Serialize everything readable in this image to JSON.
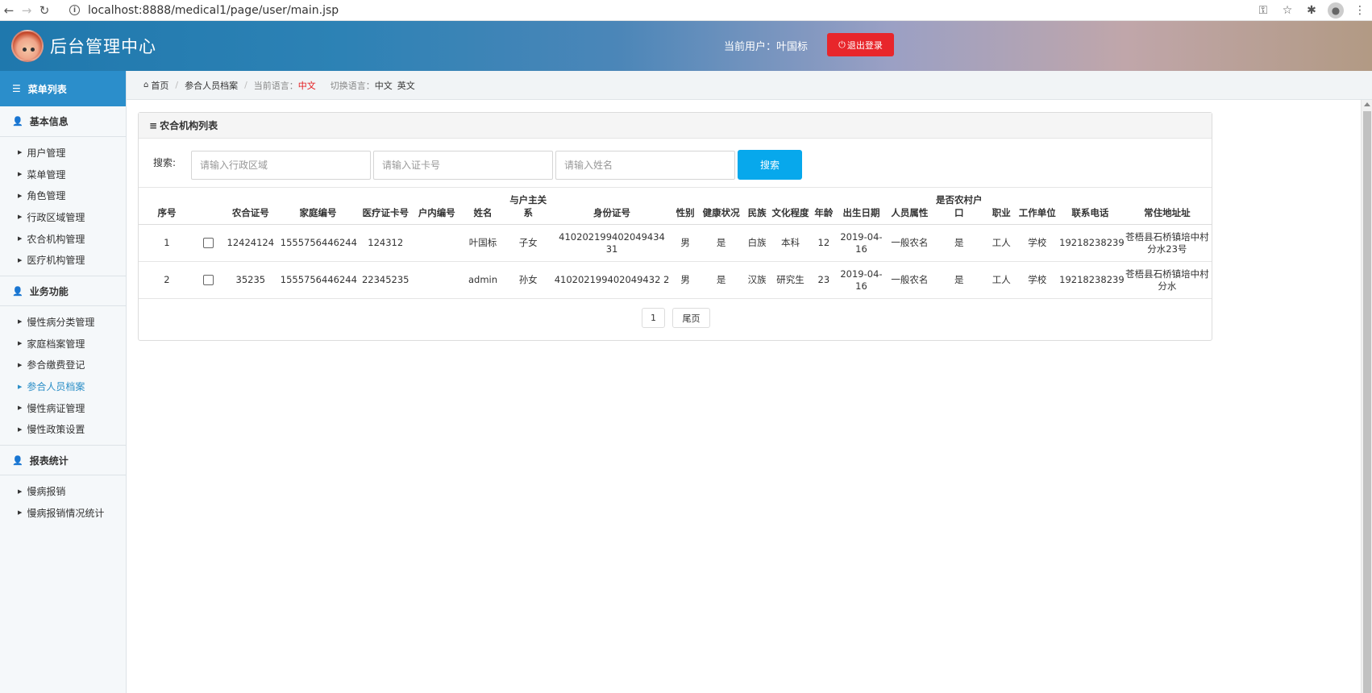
{
  "browser": {
    "url": "localhost:8888/medical1/page/user/main.jsp"
  },
  "header": {
    "title": "后台管理中心",
    "current_user_label": "当前用户：",
    "current_user": "叶国标",
    "logout_label": "退出登录"
  },
  "sidebar": {
    "menu_title": "菜单列表",
    "groups": [
      {
        "title": "基本信息",
        "items": [
          "用户管理",
          "菜单管理",
          "角色管理",
          "行政区域管理",
          "农合机构管理",
          "医疗机构管理"
        ]
      },
      {
        "title": "业务功能",
        "items": [
          "慢性病分类管理",
          "家庭档案管理",
          "参合缴费登记",
          "参合人员档案",
          "慢性病证管理",
          "慢性政策设置"
        ]
      },
      {
        "title": "报表统计",
        "items": [
          "慢病报销",
          "慢病报销情况统计"
        ]
      }
    ],
    "active_item": "参合人员档案"
  },
  "breadcrumb": {
    "home": "首页",
    "current": "参合人员档案",
    "current_lang_label": "当前语言：",
    "current_lang": "中文",
    "switch_lang_label": "切换语言：",
    "lang_options": [
      "中文",
      "英文"
    ]
  },
  "panel": {
    "title": "农合机构列表",
    "search_label": "搜索:",
    "search_placeholders": [
      "请输入行政区域",
      "请输入证卡号",
      "请输入姓名"
    ],
    "search_button": "搜索"
  },
  "table": {
    "headers": [
      "序号",
      "",
      "农合证号",
      "家庭编号",
      "医疗证卡号",
      "户内编号",
      "姓名",
      "与户主关系",
      "身份证号",
      "性别",
      "健康状况",
      "民族",
      "文化程度",
      "年龄",
      "出生日期",
      "人员属性",
      "是否农村户口",
      "职业",
      "工作单位",
      "联系电话",
      "常住地址址"
    ],
    "rows": [
      [
        "1",
        "",
        "12424124",
        "1555756446244",
        "124312",
        "",
        "叶国标",
        "子女",
        "410202199402049434 31",
        "男",
        "是",
        "白族",
        "本科",
        "12",
        "2019-04-16",
        "一般农名",
        "是",
        "工人",
        "学校",
        "19218238239",
        "苍梧县石桥镇培中村分水23号"
      ],
      [
        "2",
        "",
        "35235",
        "1555756446244",
        "22345235",
        "",
        "admin",
        "孙女",
        "410202199402049432 2",
        "男",
        "是",
        "汉族",
        "研究生",
        "23",
        "2019-04-16",
        "一般农名",
        "是",
        "工人",
        "学校",
        "19218238239",
        "苍梧县石桥镇培中村分水"
      ]
    ]
  },
  "pager": {
    "page": "1",
    "last_label": "尾页"
  }
}
